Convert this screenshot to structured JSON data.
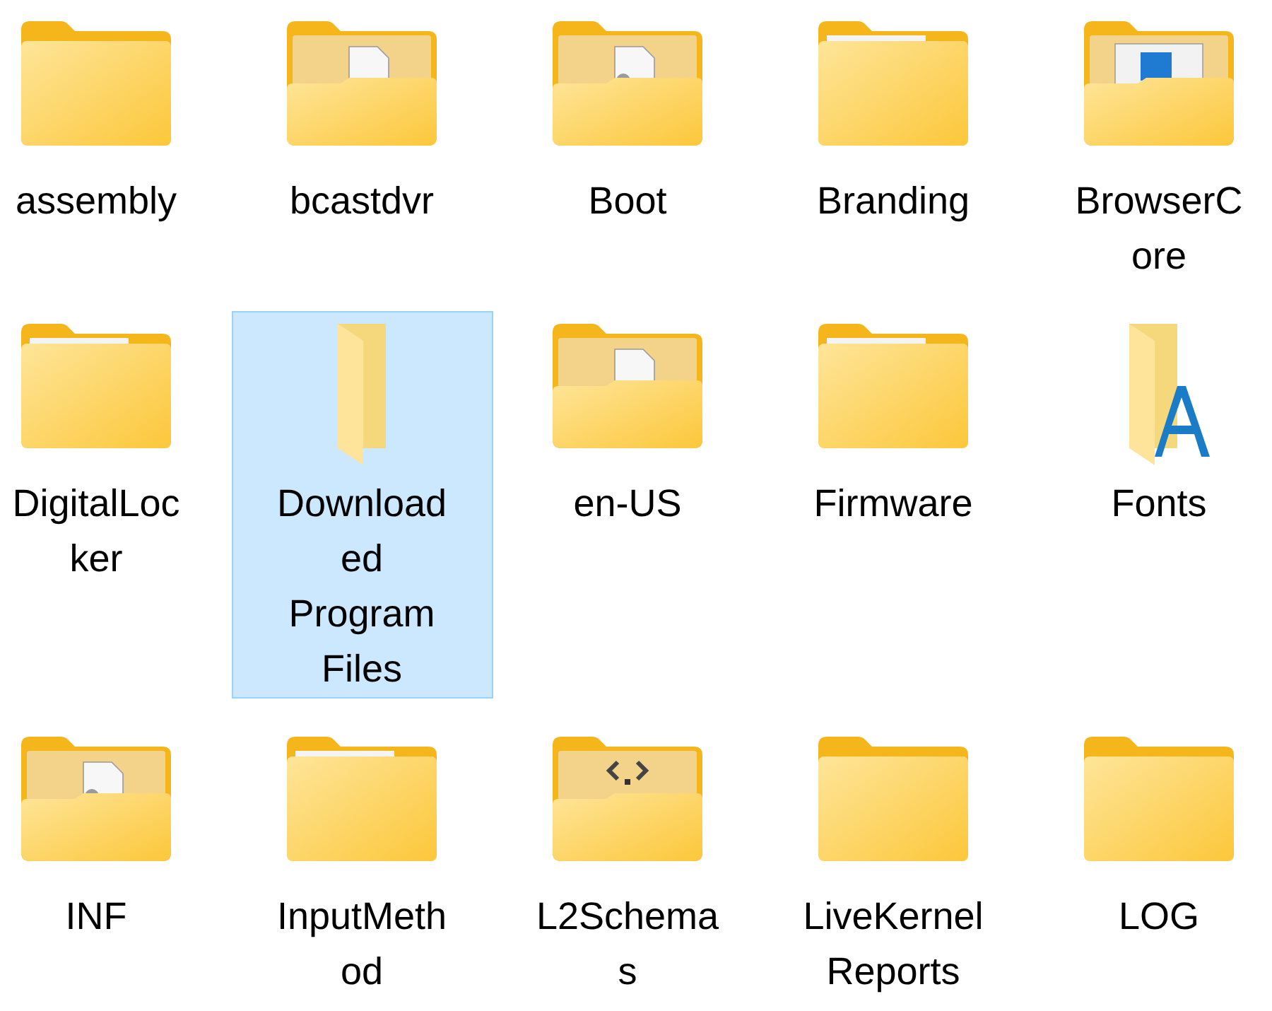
{
  "items": [
    {
      "label_lines": [
        "assembly"
      ],
      "kind": "plain",
      "selected": false
    },
    {
      "label_lines": [
        "bcastdvr"
      ],
      "kind": "document",
      "selected": false
    },
    {
      "label_lines": [
        "Boot"
      ],
      "kind": "gear",
      "selected": false
    },
    {
      "label_lines": [
        "Branding"
      ],
      "kind": "paper",
      "selected": false
    },
    {
      "label_lines": [
        "BrowserC",
        "ore"
      ],
      "kind": "window",
      "selected": false
    },
    {
      "label_lines": [
        "DigitalLoc",
        "ker"
      ],
      "kind": "paper",
      "selected": false
    },
    {
      "label_lines": [
        "Download",
        "ed",
        "Program",
        "Files"
      ],
      "kind": "open",
      "selected": true
    },
    {
      "label_lines": [
        "en-US"
      ],
      "kind": "document",
      "selected": false
    },
    {
      "label_lines": [
        "Firmware"
      ],
      "kind": "paper",
      "selected": false
    },
    {
      "label_lines": [
        "Fonts"
      ],
      "kind": "fonts",
      "selected": false
    },
    {
      "label_lines": [
        "INF"
      ],
      "kind": "gear",
      "selected": false
    },
    {
      "label_lines": [
        "InputMeth",
        "od"
      ],
      "kind": "paper",
      "selected": false
    },
    {
      "label_lines": [
        "L2Schema",
        "s"
      ],
      "kind": "code",
      "selected": false
    },
    {
      "label_lines": [
        "LiveKernel",
        "Reports"
      ],
      "kind": "plain",
      "selected": false
    },
    {
      "label_lines": [
        "LOG"
      ],
      "kind": "plain",
      "selected": false
    }
  ]
}
